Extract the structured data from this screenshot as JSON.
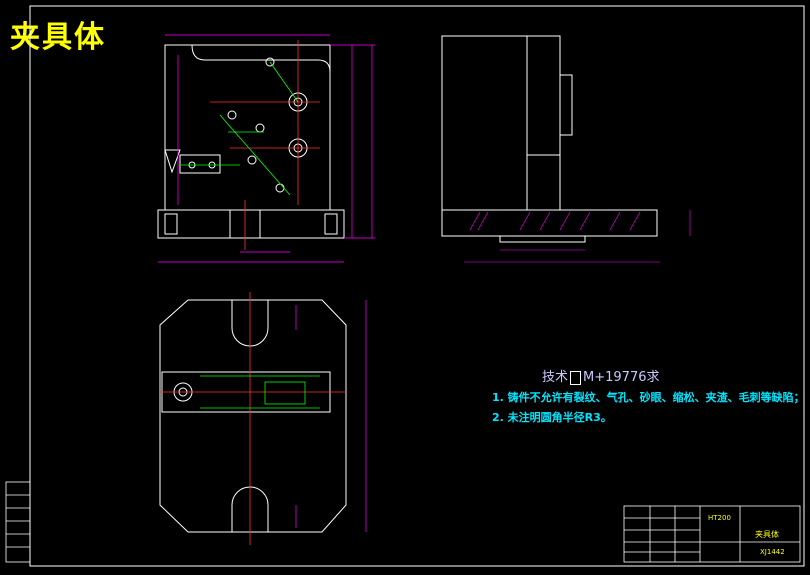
{
  "drawing": {
    "title": "夹具体",
    "notes_header_prefix": "技术",
    "notes_header_suffix": "M+19776求",
    "notes": [
      "1. 铸件不允许有裂纹、气孔、砂眼、缩松、夹渣、毛刺等缺陷；",
      "2. 未注明圆角半径R3。"
    ]
  },
  "title_block": {
    "part_name": "夹具体",
    "material": "HT200",
    "drawing_no": "XJ1442"
  },
  "colors": {
    "background": "#000000",
    "outline": "#ffffff",
    "dimension": "#ff00ff",
    "centerline": "#ff3030",
    "feature": "#00ff00",
    "title_text": "#ffff00",
    "notes_text": "#00e5ff"
  }
}
